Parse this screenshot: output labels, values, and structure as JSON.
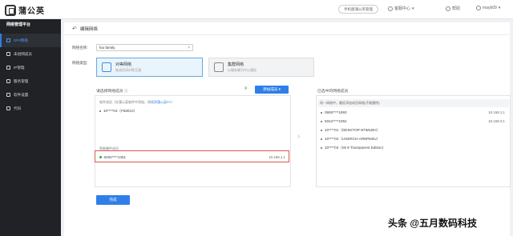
{
  "header": {
    "brand": "蒲公英",
    "pill": "手机版蒲公英管理",
    "messages": "客服中心",
    "help": "帮助",
    "user": "mayb09"
  },
  "sidebar": {
    "title": "网络管理平台",
    "items": [
      {
        "label": "SP4网络",
        "icon": "network-icon",
        "active": true
      },
      {
        "label": "未组网成员",
        "icon": "member-icon",
        "active": false
      },
      {
        "label": "IP管理",
        "icon": "ip-icon",
        "active": false
      },
      {
        "label": "服务管理",
        "icon": "service-icon",
        "active": false
      },
      {
        "label": "软件设置",
        "icon": "software-icon",
        "active": false
      },
      {
        "label": "代码",
        "icon": "code-icon",
        "active": false
      }
    ]
  },
  "page": {
    "title": "编辑网络",
    "name_label": "网络名称:",
    "name_value": "fox family",
    "type_label": "网络类型:",
    "types": [
      {
        "title": "对等网络",
        "desc": "各成员间对等互通"
      },
      {
        "title": "集群网络",
        "desc": "以服务端为中心通信"
      }
    ],
    "left_panel": {
      "title": "请选择网络成员 ⓘ",
      "add_button": "添加成员 ▾",
      "software_header": "软件成员（在蒲公英软件中添加，如",
      "software_link": "找到蒲公英PC",
      "software_header_end": "）",
      "software_rows": [
        {
          "name": "10****03（F58010）",
          "ip": ""
        }
      ],
      "hardware_header": "智能硬件成员",
      "hardware_rows": [
        {
          "name": "6292****1351",
          "ip": "10.168.1.1"
        }
      ]
    },
    "right_panel": {
      "title": "已选中的网络成员",
      "header": "同一网络中，最低添加成员网络(不能删除)",
      "rows": [
        {
          "name": "0993****1893",
          "ip": "10.168.1.1"
        },
        {
          "name": "9344****1052",
          "ip": "10.168.3.1"
        },
        {
          "name": "10****01（DESKTOP-97IMLBH）",
          "ip": ""
        },
        {
          "name": "10****02（USERCH-AR8PM2U）",
          "ip": ""
        },
        {
          "name": "10****04（Mi 9 Transparent Edition）",
          "ip": ""
        }
      ]
    },
    "done_button": "完成"
  },
  "watermark": "头条 @五月数码科技"
}
